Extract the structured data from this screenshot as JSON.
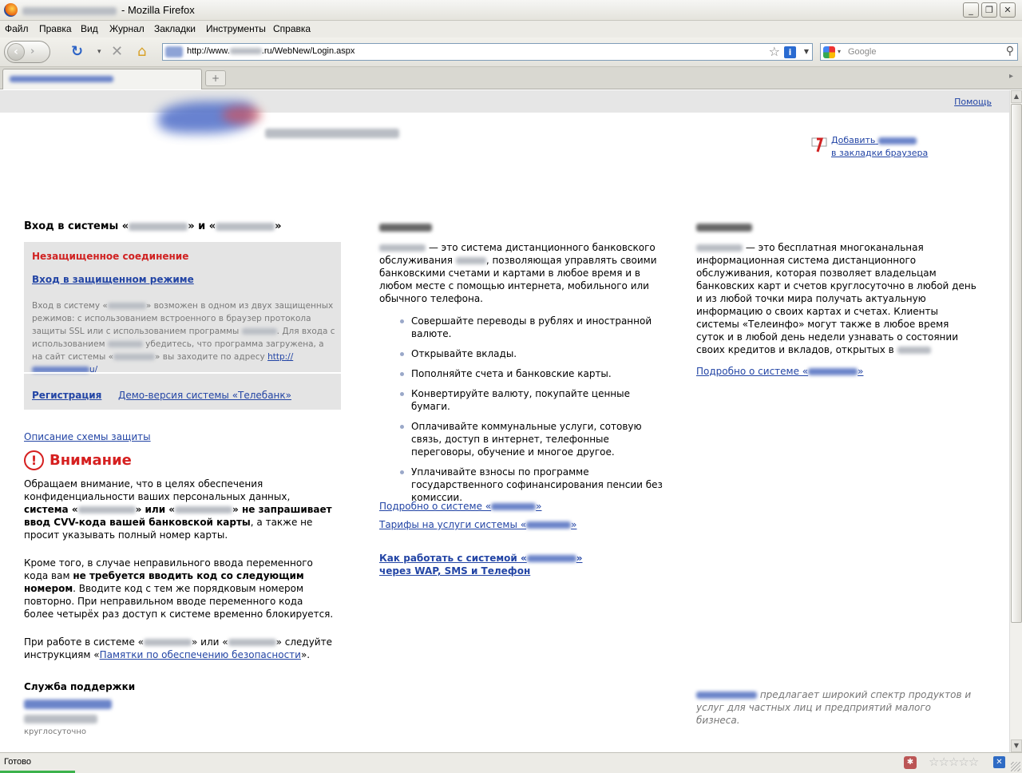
{
  "window": {
    "title_suffix": "- Mozilla Firefox",
    "buttons": [
      "_",
      "❐",
      "✕"
    ]
  },
  "menu": [
    "Файл",
    "Правка",
    "Вид",
    "Журнал",
    "Закладки",
    "Инструменты",
    "Справка"
  ],
  "navbar": {
    "url_prefix": "http://www.",
    "url_suffix": ".ru/WebNew/Login.aspx",
    "search_placeholder": "Google"
  },
  "page": {
    "help": "Помощь",
    "bookmark": {
      "line1": "Добавить",
      "line2": "в закладки браузера"
    },
    "login": {
      "title_start": "Вход в системы «",
      "title_mid": "» и «",
      "title_end": "»",
      "insecure": "Незащищенное соединение",
      "secure_link": "Вход в защищенном режиме",
      "desc": {
        "p1": "Вход в систему «",
        "p2": "» возможен в одном из двух защищенных режимов: с использованием встроенного в браузер протокола защиты SSL или с использованием программы ",
        "p3": ". Для входа с использованием ",
        "p4": " убедитесь, что программа загружена, а на сайт системы «",
        "p5": "» вы заходите по адресу ",
        "link_start": "http://",
        "link_end": "u/"
      },
      "register": "Регистрация",
      "demo": "Демо-версия системы «Телебанк»"
    },
    "scheme_link": "Описание схемы защиты",
    "attention": "Внимание",
    "attention_icon": "!",
    "para1": {
      "a": "Обращаем внимание, что в целях обеспечения конфиденциальности ваших персональных данных, ",
      "b1": "система «",
      "b2": "» или «",
      "b3": "» не запрашивает ввод CVV-кода вашей банковской карты",
      "c": ", а также не просит указывать полный номер карты."
    },
    "para2": {
      "a": "Кроме того, в случае неправильного ввода переменного кода вам ",
      "b": "не требуется вводить код со следующим номером",
      "c": ". Вводите код с тем же порядковым номером повторно. При неправильном вводе переменного кода более четырёх раз доступ к системе временно блокируется."
    },
    "para3": {
      "a": "При работе в системе «",
      "b": "» или «",
      "c": "» следуйте инструкциям «",
      "link": "Памятки по обеспечению безопасности",
      "d": "»."
    },
    "support": {
      "title": "Служба поддержки",
      "note": "круглосуточно"
    },
    "middle": {
      "intro_a": " — это система дистанционного банковского обслуживания ",
      "intro_b": ", позволяющая управлять своими банковскими счетами и картами в любое время и в любом месте с помощью интернета, мобильного или обычного телефона.",
      "bullets": [
        "Совершайте переводы в рублях и иностранной валюте.",
        "Открывайте вклады.",
        "Пополняйте счета и банковские карты.",
        "Конвертируйте валюту, покупайте ценные бумаги.",
        "Оплачивайте коммунальные услуги, сотовую связь, доступ в интернет, телефонные переговоры, обучение и многое другое.",
        "Уплачивайте взносы по программе государственного софинансирования пенсии без комиссии."
      ],
      "link1_start": "Подробно о системе «",
      "link1_end": "»",
      "link2_start": "Тарифы на услуги системы «",
      "link2_end": "»",
      "bold_link_l1_start": "Как работать с системой «",
      "bold_link_l1_end": "»",
      "bold_link_l2": "через WAP, SMS и Телефон"
    },
    "right": {
      "intro_a": " — это бесплатная многоканальная информационная система дистанционного обслуживания, которая позволяет владельцам банковских карт и счетов круглосуточно в любой день и из любой точки мира получать актуальную информацию о своих картах и счетах. Клиенты системы «Телеинфо» могут также в любое время суток и в любой день недели узнавать о состоянии своих кредитов и вкладов, открытых в ",
      "intro_b": "",
      "link_start": "Подробно о системе «",
      "link_end": "»",
      "footer_a": " предлагает широкий спектр продуктов и услуг для частных лиц и предприятий малого бизнеса."
    }
  },
  "status": {
    "text": "Готово"
  }
}
